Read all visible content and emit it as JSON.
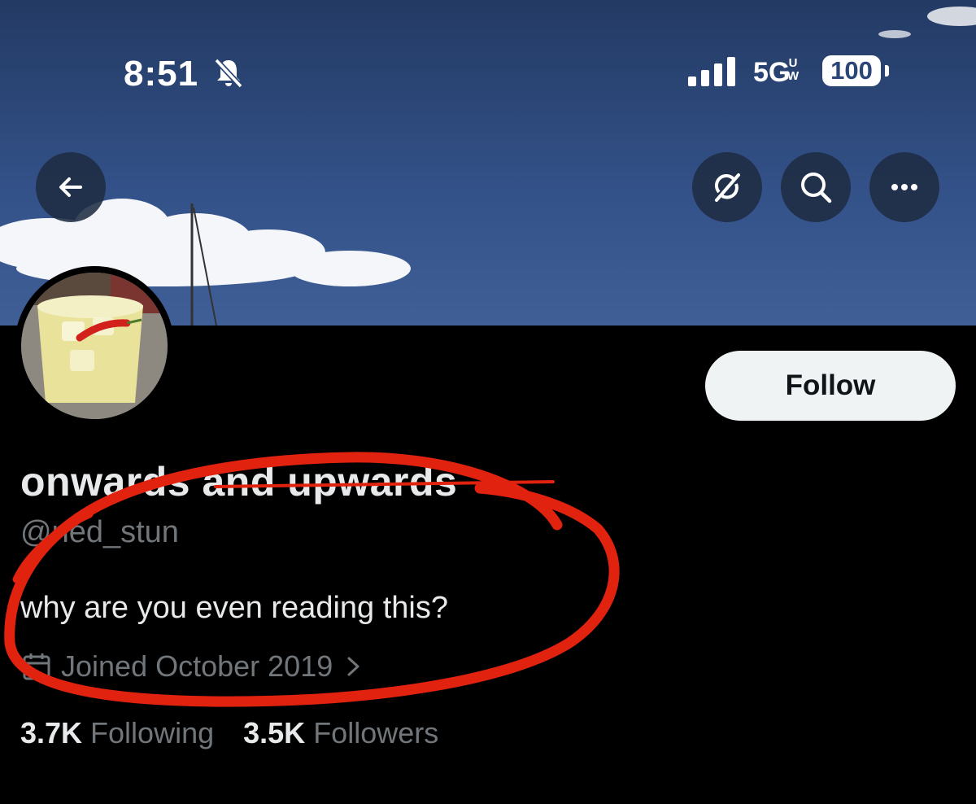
{
  "status_bar": {
    "time": "8:51",
    "network": "5G",
    "network_sub_top": "U",
    "network_sub_bottom": "W",
    "battery": "100"
  },
  "header": {
    "back_icon": "arrow-left-icon",
    "actions": [
      "grok-icon",
      "search-icon",
      "more-icon"
    ]
  },
  "profile": {
    "display_name": "onwards and upwards",
    "handle": "@ned_stun",
    "bio": "why are you even reading this?",
    "joined": "Joined October 2019",
    "following_count": "3.7K",
    "following_label": "Following",
    "followers_count": "3.5K",
    "followers_label": "Followers",
    "follow_button": "Follow"
  },
  "colors": {
    "annotation": "#e0220f",
    "secondary_text": "#71767b",
    "primary_text": "#e7e9ea"
  }
}
